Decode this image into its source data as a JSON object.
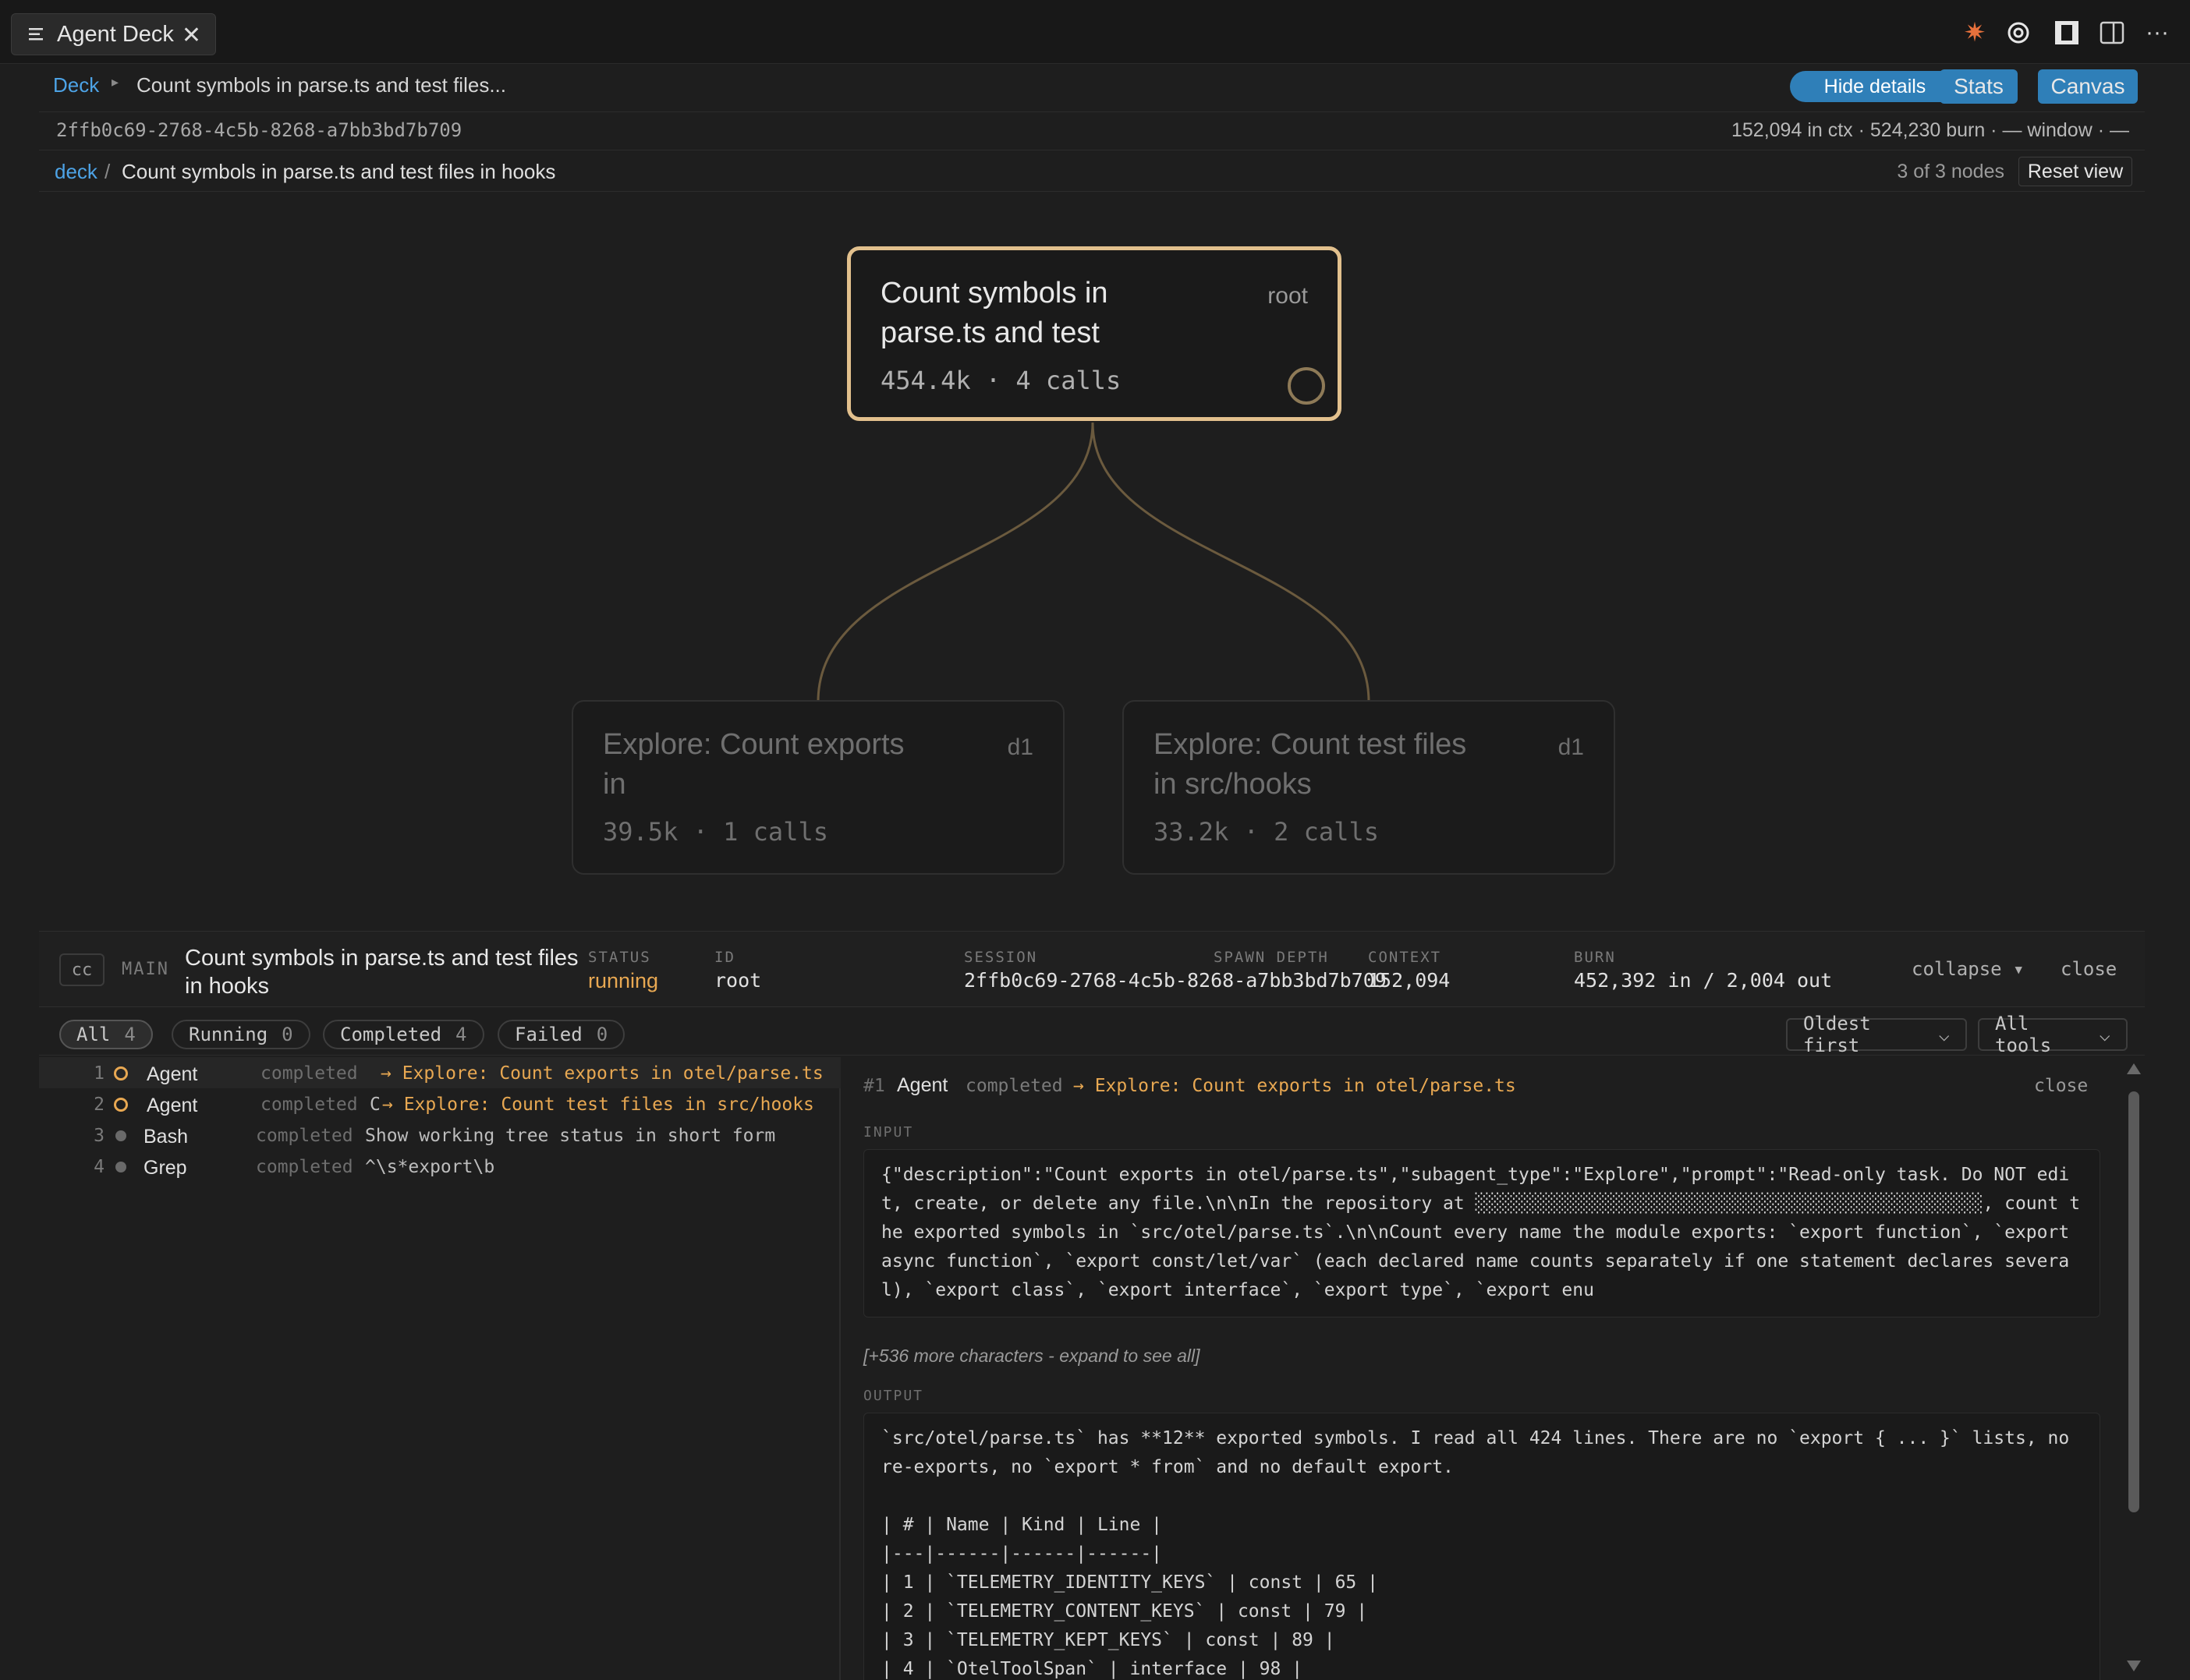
{
  "tab": {
    "title": "Agent Deck"
  },
  "toolbar_icons": [
    "claude-icon",
    "openai-icon",
    "square-icon",
    "split-editor-icon",
    "more-icon"
  ],
  "breadcrumb": {
    "root": "Deck",
    "title": "Count symbols in parse.ts and test files..."
  },
  "actions": {
    "hide_details": "Hide details",
    "stats": "Stats",
    "canvas": "Canvas"
  },
  "session": {
    "id": "2ffb0c69-2768-4c5b-8268-a7bb3bd7b709",
    "stats": "152,094 in ctx · 524,230 burn · — window · —"
  },
  "path": {
    "root": "deck",
    "sep": "/",
    "title": "Count symbols in parse.ts and test files in hooks",
    "nodes_count": "3 of 3 nodes",
    "reset": "Reset view"
  },
  "graph": {
    "root": {
      "title": "Count symbols in parse.ts and test",
      "tag": "root",
      "meta": "454.4k · 4 calls"
    },
    "children": [
      {
        "title": "Explore: Count exports in",
        "tag": "d1",
        "meta": "39.5k · 1 calls"
      },
      {
        "title": "Explore: Count test files in src/hooks",
        "tag": "d1",
        "meta": "33.2k · 2 calls"
      }
    ]
  },
  "detail": {
    "badge": "cc",
    "kind": "MAIN",
    "name": "Count symbols in parse.ts and test files in hooks",
    "fields": {
      "status_label": "STATUS",
      "status": "running",
      "id_label": "ID",
      "id": "root",
      "session_label": "SESSION",
      "session": "2ffb0c69-2768-4c5b-8268-a7bb3bd7b709",
      "depth_label": "SPAWN DEPTH",
      "context_label": "CONTEXT",
      "context": "152,094",
      "burn_label": "BURN",
      "burn": "452,392 in / 2,004 out"
    },
    "collapse": "collapse ▾",
    "close": "close"
  },
  "filters": {
    "all": {
      "label": "All",
      "count": "4"
    },
    "running": {
      "label": "Running",
      "count": "0"
    },
    "completed": {
      "label": "Completed",
      "count": "4"
    },
    "failed": {
      "label": "Failed",
      "count": "0"
    },
    "sort": "Oldest first",
    "tools": "All tools"
  },
  "events": [
    {
      "num": "1",
      "tool": "Agent",
      "state": "completed",
      "mark": "",
      "desc": "→ Explore: Count exports in otel/parse.ts"
    },
    {
      "num": "2",
      "tool": "Agent",
      "state": "completed",
      "mark": "C",
      "desc": "→ Explore: Count test files in src/hooks"
    },
    {
      "num": "3",
      "tool": "Bash",
      "state": "completed",
      "mark": "",
      "desc": "Show working tree status in short form"
    },
    {
      "num": "4",
      "tool": "Grep",
      "state": "completed",
      "mark": "",
      "desc": "^\\s*export\\b"
    }
  ],
  "event_detail": {
    "num": "#1",
    "tool": "Agent",
    "state": "completed",
    "target": "→ Explore: Count exports in otel/parse.ts",
    "close": "close",
    "input_label": "INPUT",
    "input": "{\"description\":\"Count exports in otel/parse.ts\",\"subagent_type\":\"Explore\",\"prompt\":\"Read-only task. Do NOT edit, create, or delete any file.\\n\\nIn the repository at ░░░░░░░░░░░░░░░░░░░░░░░░░░░░░░░░░░░░░░░░░░░░░░░, count the exported symbols in `src/otel/parse.ts`.\\n\\nCount every name the module exports: `export function`, `export async function`, `export const/let/var` (each declared name counts separately if one statement declares several), `export class`, `export interface`, `export type`, `export enu",
    "more": "[+536 more characters - expand to see all]",
    "output_label": "OUTPUT",
    "output": "`src/otel/parse.ts` has **12** exported symbols. I read all 424 lines. There are no `export { ... }` lists, no re-exports, no `export * from` and no default export.\n\n| # | Name | Kind | Line |\n|---|------|------|------|\n| 1 | `TELEMETRY_IDENTITY_KEYS` | const | 65 |\n| 2 | `TELEMETRY_CONTENT_KEYS` | const | 79 |\n| 3 | `TELEMETRY_KEPT_KEYS` | const | 89 |\n| 4 | `OtelToolSpan` | interface | 98 |"
  },
  "colors": {
    "accent": "#e2c08d",
    "link": "#4da3e6",
    "running": "#e8a852",
    "button": "#2f7fb8"
  }
}
